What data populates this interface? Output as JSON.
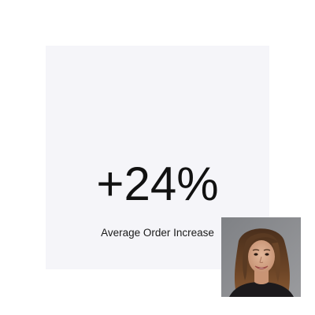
{
  "stat": {
    "value": "+24%",
    "caption": "Average Order Increase"
  },
  "photo": {
    "subject": "portrait-of-smiling-woman-with-long-brown-hair"
  },
  "colors": {
    "page_background": "#ffffff",
    "card_background": "#f5f5f9",
    "text": "#111111"
  }
}
